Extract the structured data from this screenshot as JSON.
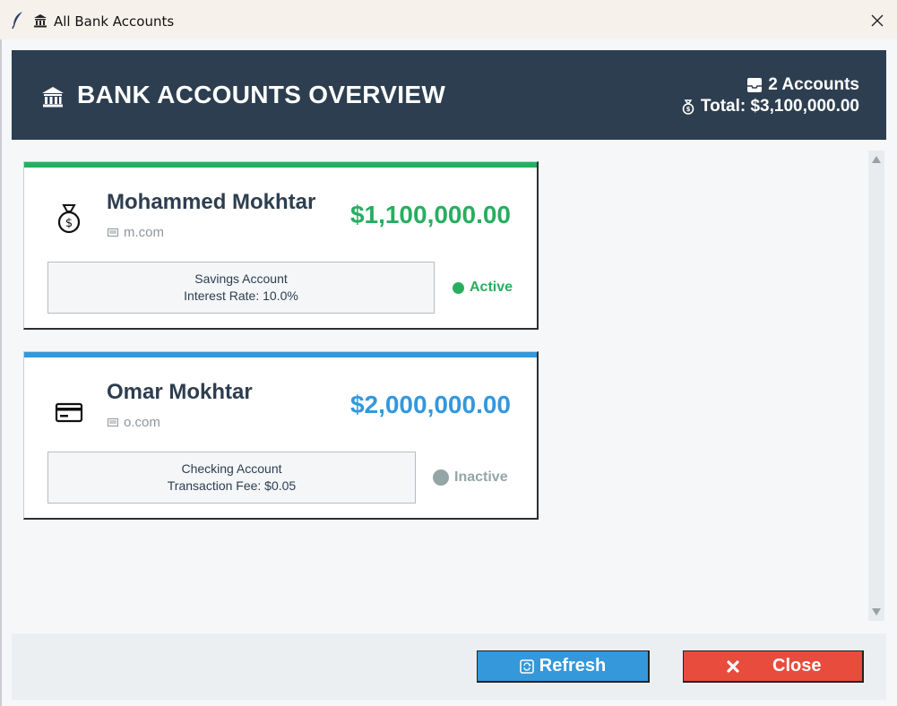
{
  "window": {
    "title": "All Bank Accounts",
    "feather_icon": "feather-icon",
    "bank_icon": "bank-icon",
    "close_icon": "close-icon"
  },
  "header": {
    "title": "BANK ACCOUNTS OVERVIEW",
    "accounts_count": "2 Accounts",
    "total": "Total: $3,100,000.00",
    "background": "#2d3e50"
  },
  "accounts": [
    {
      "name": "Mohammed Mokhtar",
      "email": "m.com",
      "balance": "$1,100,000.00",
      "account_type": "Savings Account",
      "detail": "Interest Rate: 10.0%",
      "status": "Active",
      "icon": "money-bag-icon",
      "accent": "#27ae60",
      "status_color": "#27ae60"
    },
    {
      "name": "Omar Mokhtar",
      "email": "o.com",
      "balance": "$2,000,000.00",
      "account_type": "Checking Account",
      "detail": "Transaction Fee: $0.05",
      "status": "Inactive",
      "icon": "credit-card-icon",
      "accent": "#3498db",
      "status_color": "#95a5a6"
    }
  ],
  "footer": {
    "refresh_label": "Refresh",
    "close_label": "Close",
    "refresh_color": "#3498db",
    "close_color": "#e74c3c"
  }
}
